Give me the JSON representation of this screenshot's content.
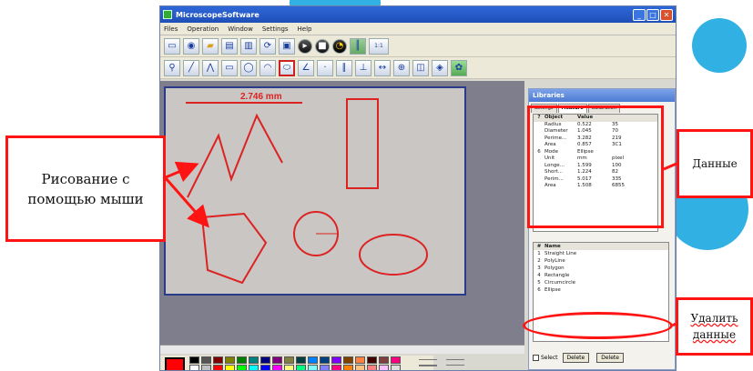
{
  "colors": {
    "annotation": "#ff1414",
    "window_title": "#2f67d8",
    "workspace": "#7e7e8c",
    "canvas": "#c9c6c4",
    "shape_stroke": "#dd2222"
  },
  "window": {
    "title": "MicroscopeSoftware",
    "controls": {
      "minimize": "_",
      "maximize": "□",
      "close": "✕"
    }
  },
  "menu": [
    "Files",
    "Operation",
    "Window",
    "Settings",
    "Help"
  ],
  "toolbar1": [
    {
      "icon": "monitor-icon"
    },
    {
      "icon": "camera-icon"
    },
    {
      "icon": "folder-open-icon"
    },
    {
      "icon": "image-icon"
    },
    {
      "icon": "image-copy-icon"
    },
    {
      "icon": "refresh-icon"
    },
    {
      "icon": "save-icon"
    },
    {
      "icon": "play-icon"
    },
    {
      "icon": "stop-icon"
    },
    {
      "icon": "gauge-icon"
    },
    {
      "icon": "ruler-icon"
    }
  ],
  "toolbar1_text": "1:1",
  "toolbar2": [
    {
      "icon": "magnifier-icon"
    },
    {
      "icon": "line-icon"
    },
    {
      "icon": "polyline-icon"
    },
    {
      "icon": "rectangle-icon"
    },
    {
      "icon": "circle-icon"
    },
    {
      "icon": "arc-icon"
    },
    {
      "icon": "ellipse-icon"
    },
    {
      "icon": "angle-icon"
    },
    {
      "icon": "point-icon"
    },
    {
      "icon": "parallel-icon"
    },
    {
      "icon": "perpendicular-icon"
    },
    {
      "icon": "distance-icon"
    },
    {
      "icon": "crosshair-icon"
    },
    {
      "icon": "split-icon"
    },
    {
      "icon": "arrow-icon"
    },
    {
      "icon": "palette-icon"
    }
  ],
  "canvas": {
    "measurement_label": "2.746 mm"
  },
  "libraries": {
    "title": "Libraries",
    "tabs": [
      "Settings",
      "Measure",
      "Calibration"
    ],
    "grid_headers": [
      "?",
      "Object",
      "Value",
      ""
    ],
    "grid_rows": [
      [
        "",
        "Radius",
        "0.522",
        "35"
      ],
      [
        "",
        "Diameter",
        "1.045",
        "70"
      ],
      [
        "",
        "Perime...",
        "3.282",
        "219"
      ],
      [
        "",
        "Area",
        "0.857",
        "3C1"
      ],
      [
        "6",
        "Mode",
        "Ellipse",
        ""
      ],
      [
        "",
        "Unit",
        "mm",
        "pixel"
      ],
      [
        "",
        "Longe...",
        "1.599",
        "100"
      ],
      [
        "",
        "Short...",
        "1.224",
        "82"
      ],
      [
        "",
        "Perim...",
        "5.017",
        "335"
      ],
      [
        "",
        "Area",
        "1.508",
        "6855"
      ]
    ],
    "list_header": [
      "#",
      "Name"
    ],
    "list_rows": [
      [
        "1",
        "Straight Line"
      ],
      [
        "2",
        "PolyLine"
      ],
      [
        "3",
        "Polygon"
      ],
      [
        "4",
        "Rectangle"
      ],
      [
        "5",
        "Circumcircle"
      ],
      [
        "6",
        "Ellipse"
      ]
    ],
    "select_label": "Select",
    "delete_label": "Delete",
    "delete_all_label": "Delete"
  },
  "annotations": {
    "left": "Рисование с помощью мыши",
    "data": "Данные",
    "delete": "Удалить данные"
  }
}
